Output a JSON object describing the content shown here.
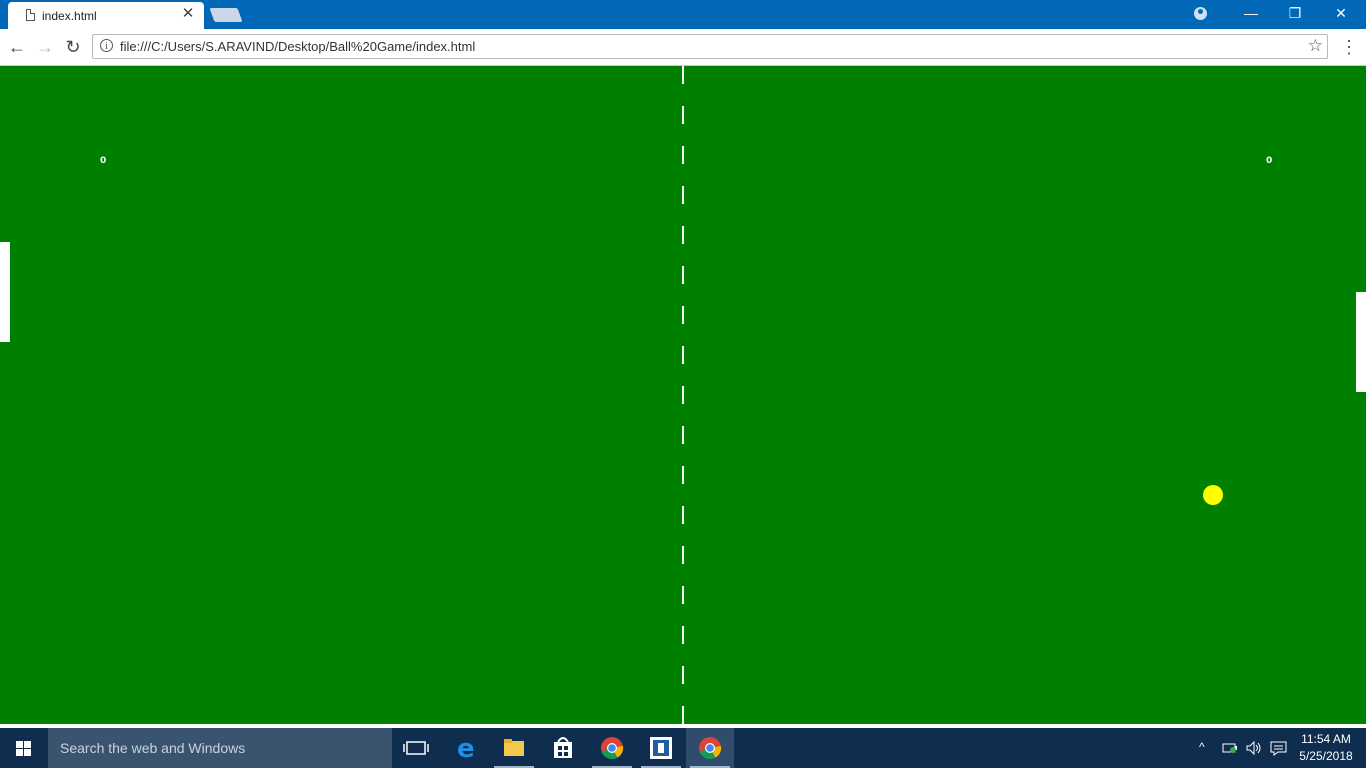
{
  "browser": {
    "tab_title": "index.html",
    "tab_close": "✕",
    "url": "file:///C:/Users/S.ARAVIND/Desktop/Ball%20Game/index.html",
    "window_minimize": "—",
    "window_restore": "❐",
    "window_close": "✕",
    "nav_back": "←",
    "nav_forward": "→",
    "nav_reload": "↻",
    "bookmark_star": "☆",
    "menu": "⋮",
    "info": "i"
  },
  "game": {
    "left_score": "0",
    "right_score": "0",
    "colors": {
      "field": "#008000",
      "net": "#ffffff",
      "paddle": "#ffffff",
      "ball": "#ffff00"
    }
  },
  "taskbar": {
    "search_placeholder": "Search the web and Windows",
    "apps": [
      "task-view-icon",
      "edge-icon",
      "file-explorer-icon",
      "store-icon",
      "chrome-icon",
      "app-icon",
      "chrome-icon"
    ],
    "time": "11:54 AM",
    "date": "5/25/2018"
  }
}
